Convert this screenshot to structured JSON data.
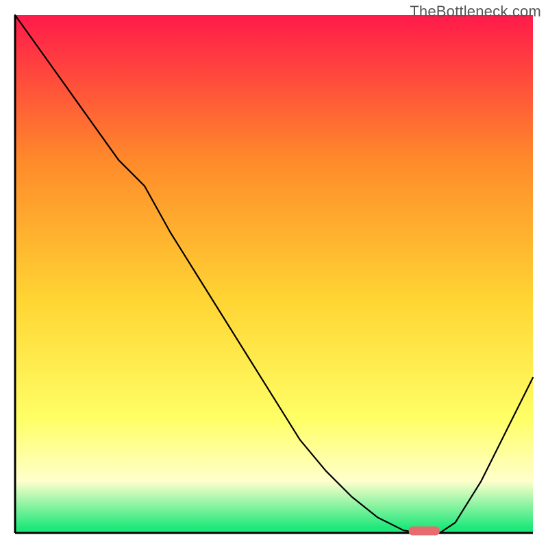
{
  "watermark": "TheBottleneck.com",
  "colors": {
    "gradient_top": "#ff1a4a",
    "gradient_upper_mid": "#ff8a2a",
    "gradient_mid": "#ffd533",
    "gradient_lower_mid": "#ffff66",
    "gradient_pale": "#ffffcc",
    "gradient_green": "#1fe87a",
    "curve": "#000000",
    "marker": "#e66a6e",
    "axis": "#000000"
  },
  "chart_data": {
    "type": "line",
    "title": "",
    "xlabel": "",
    "ylabel": "",
    "x": [
      0.0,
      0.05,
      0.1,
      0.15,
      0.2,
      0.25,
      0.3,
      0.35,
      0.4,
      0.45,
      0.5,
      0.55,
      0.6,
      0.65,
      0.7,
      0.75,
      0.78,
      0.8,
      0.82,
      0.85,
      0.9,
      0.95,
      1.0
    ],
    "values": [
      1.0,
      0.93,
      0.86,
      0.79,
      0.72,
      0.67,
      0.58,
      0.5,
      0.42,
      0.34,
      0.26,
      0.18,
      0.12,
      0.07,
      0.03,
      0.005,
      0.0,
      0.0,
      0.0,
      0.02,
      0.1,
      0.2,
      0.3
    ],
    "xlim": [
      0,
      1
    ],
    "ylim": [
      0,
      1
    ],
    "marker": {
      "x_start": 0.76,
      "x_end": 0.82,
      "y": 0.004
    },
    "annotations": []
  }
}
